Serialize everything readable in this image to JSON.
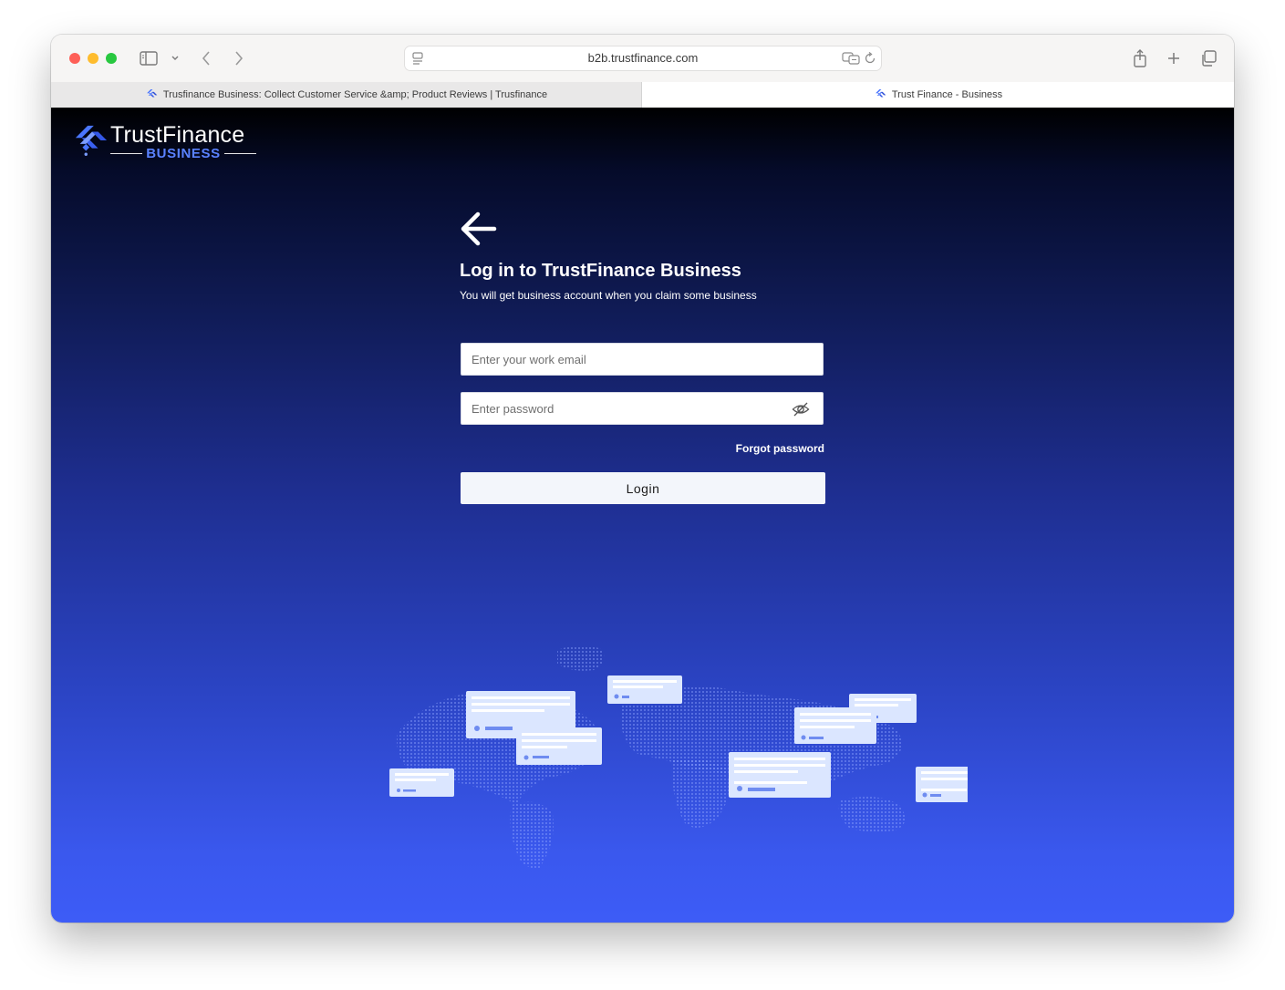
{
  "browser": {
    "url": "b2b.trustfinance.com",
    "tabs": [
      {
        "label": "Trusfinance Business: Collect Customer Service &amp; Product Reviews | Trusfinance",
        "active": false
      },
      {
        "label": "Trust Finance - Business",
        "active": true
      }
    ]
  },
  "logo": {
    "name": "TrustFinance",
    "subtitle": "BUSINESS"
  },
  "login": {
    "title": "Log in to TrustFinance Business",
    "subtitle": "You will get business account when you claim some business",
    "email_placeholder": "Enter your work email",
    "password_placeholder": "Enter password",
    "forgot_label": "Forgot password",
    "login_label": "Login"
  },
  "colors": {
    "accent": "#3d5cf7",
    "logo_blue": "#5a82ff",
    "page_top": "#000000"
  }
}
